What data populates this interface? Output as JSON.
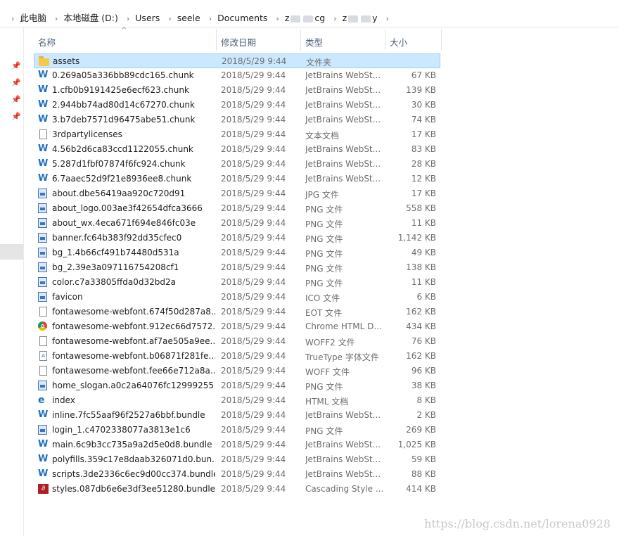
{
  "breadcrumb": [
    "此电脑",
    "本地磁盘 (D:)",
    "Users",
    "seele",
    "Documents",
    "z",
    "cg",
    "z",
    "y"
  ],
  "columns": {
    "name": "名称",
    "date": "修改日期",
    "type": "类型",
    "size": "大小"
  },
  "files": [
    {
      "name": "assets",
      "date": "2018/5/29 9:44",
      "type": "文件夹",
      "size": "",
      "icon": "folder"
    },
    {
      "name": "0.269a05a336bb89cdc165.chunk",
      "date": "2018/5/29 9:44",
      "type": "JetBrains WebSt...",
      "size": "67 KB",
      "icon": "webstorm"
    },
    {
      "name": "1.cfb0b9191425e6ecf623.chunk",
      "date": "2018/5/29 9:44",
      "type": "JetBrains WebSt...",
      "size": "139 KB",
      "icon": "webstorm"
    },
    {
      "name": "2.944bb74ad80d14c67270.chunk",
      "date": "2018/5/29 9:44",
      "type": "JetBrains WebSt...",
      "size": "30 KB",
      "icon": "webstorm"
    },
    {
      "name": "3.b7deb7571d96475abe51.chunk",
      "date": "2018/5/29 9:44",
      "type": "JetBrains WebSt...",
      "size": "74 KB",
      "icon": "webstorm"
    },
    {
      "name": "3rdpartylicenses",
      "date": "2018/5/29 9:44",
      "type": "文本文档",
      "size": "17 KB",
      "icon": "doc"
    },
    {
      "name": "4.56b2d6ca83ccd1122055.chunk",
      "date": "2018/5/29 9:44",
      "type": "JetBrains WebSt...",
      "size": "83 KB",
      "icon": "webstorm"
    },
    {
      "name": "5.287d1fbf07874f6fc924.chunk",
      "date": "2018/5/29 9:44",
      "type": "JetBrains WebSt...",
      "size": "28 KB",
      "icon": "webstorm"
    },
    {
      "name": "6.7aaec52d9f21e8936ee8.chunk",
      "date": "2018/5/29 9:44",
      "type": "JetBrains WebSt...",
      "size": "12 KB",
      "icon": "webstorm"
    },
    {
      "name": "about.dbe56419aa920c720d91",
      "date": "2018/5/29 9:44",
      "type": "JPG 文件",
      "size": "17 KB",
      "icon": "image"
    },
    {
      "name": "about_logo.003ae3f42654dfca3666",
      "date": "2018/5/29 9:44",
      "type": "PNG 文件",
      "size": "558 KB",
      "icon": "image"
    },
    {
      "name": "about_wx.4eca671f694e846fc03e",
      "date": "2018/5/29 9:44",
      "type": "PNG 文件",
      "size": "11 KB",
      "icon": "image"
    },
    {
      "name": "banner.fc64b383f92dd35cfec0",
      "date": "2018/5/29 9:44",
      "type": "PNG 文件",
      "size": "1,142 KB",
      "icon": "image"
    },
    {
      "name": "bg_1.4b66cf491b74480d531a",
      "date": "2018/5/29 9:44",
      "type": "PNG 文件",
      "size": "49 KB",
      "icon": "image"
    },
    {
      "name": "bg_2.39e3a097116754208cf1",
      "date": "2018/5/29 9:44",
      "type": "PNG 文件",
      "size": "138 KB",
      "icon": "image"
    },
    {
      "name": "color.c7a33805ffda0d32bd2a",
      "date": "2018/5/29 9:44",
      "type": "PNG 文件",
      "size": "11 KB",
      "icon": "image"
    },
    {
      "name": "favicon",
      "date": "2018/5/29 9:44",
      "type": "ICO 文件",
      "size": "6 KB",
      "icon": "image"
    },
    {
      "name": "fontawesome-webfont.674f50d287a8...",
      "date": "2018/5/29 9:44",
      "type": "EOT 文件",
      "size": "162 KB",
      "icon": "doc"
    },
    {
      "name": "fontawesome-webfont.912ec66d7572...",
      "date": "2018/5/29 9:44",
      "type": "Chrome HTML D...",
      "size": "434 KB",
      "icon": "chrome"
    },
    {
      "name": "fontawesome-webfont.af7ae505a9ee...",
      "date": "2018/5/29 9:44",
      "type": "WOFF2 文件",
      "size": "76 KB",
      "icon": "doc"
    },
    {
      "name": "fontawesome-webfont.b06871f281fe...",
      "date": "2018/5/29 9:44",
      "type": "TrueType 字体文件",
      "size": "162 KB",
      "icon": "font"
    },
    {
      "name": "fontawesome-webfont.fee66e712a8a...",
      "date": "2018/5/29 9:44",
      "type": "WOFF 文件",
      "size": "96 KB",
      "icon": "doc"
    },
    {
      "name": "home_slogan.a0c2a64076fc12999255",
      "date": "2018/5/29 9:44",
      "type": "PNG 文件",
      "size": "38 KB",
      "icon": "image"
    },
    {
      "name": "index",
      "date": "2018/5/29 9:44",
      "type": "HTML 文档",
      "size": "8 KB",
      "icon": "ie"
    },
    {
      "name": "inline.7fc55aaf96f2527a6bbf.bundle",
      "date": "2018/5/29 9:44",
      "type": "JetBrains WebSt...",
      "size": "2 KB",
      "icon": "webstorm"
    },
    {
      "name": "login_1.c4702338077a3813e1c6",
      "date": "2018/5/29 9:44",
      "type": "PNG 文件",
      "size": "269 KB",
      "icon": "image"
    },
    {
      "name": "main.6c9b3cc735a9a2d5e0d8.bundle",
      "date": "2018/5/29 9:44",
      "type": "JetBrains WebSt...",
      "size": "1,025 KB",
      "icon": "webstorm"
    },
    {
      "name": "polyfills.359c17e8daab326071d0.bun...",
      "date": "2018/5/29 9:44",
      "type": "JetBrains WebSt...",
      "size": "59 KB",
      "icon": "webstorm"
    },
    {
      "name": "scripts.3de2336c6ec9d00cc374.bundle",
      "date": "2018/5/29 9:44",
      "type": "JetBrains WebSt...",
      "size": "88 KB",
      "icon": "webstorm"
    },
    {
      "name": "styles.087db6e6e3df3ee51280.bundle",
      "date": "2018/5/29 9:44",
      "type": "Cascading Style ...",
      "size": "414 KB",
      "icon": "css"
    }
  ],
  "selected_index": 0,
  "watermark": "https://blog.csdn.net/lorena0928"
}
